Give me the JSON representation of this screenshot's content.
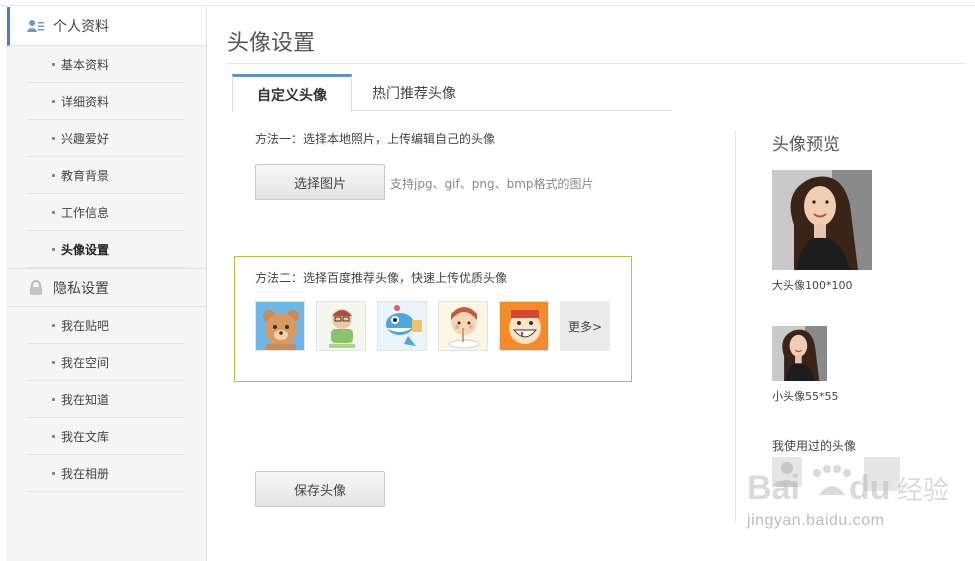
{
  "sidebar": {
    "profile_section": {
      "label": "个人资料",
      "icon": "user-card-icon"
    },
    "profile_items": [
      {
        "label": "基本资料"
      },
      {
        "label": "详细资料"
      },
      {
        "label": "兴趣爱好"
      },
      {
        "label": "教育背景"
      },
      {
        "label": "工作信息"
      },
      {
        "label": "头像设置",
        "current": true
      }
    ],
    "privacy_section": {
      "label": "隐私设置",
      "icon": "lock-icon"
    },
    "privacy_items": [
      {
        "label": "我在贴吧"
      },
      {
        "label": "我在空间"
      },
      {
        "label": "我在知道"
      },
      {
        "label": "我在文库"
      },
      {
        "label": "我在相册"
      }
    ]
  },
  "main": {
    "title": "头像设置",
    "tabs": [
      {
        "label": "自定义头像",
        "active": true
      },
      {
        "label": "热门推荐头像",
        "active": false
      }
    ],
    "method1": {
      "text": "方法一：选择本地照片，上传编辑自己的头像",
      "button": "选择图片",
      "hint": "支持jpg、gif、png、bmp格式的图片"
    },
    "method2": {
      "text": "方法二：选择百度推荐头像，快速上传优质头像",
      "avatars": [
        "bear-avatar",
        "grandpa-avatar",
        "fish-avatar",
        "girl-eating-avatar",
        "smiling-face-avatar"
      ],
      "more": "更多>"
    },
    "save_button": "保存头像"
  },
  "preview": {
    "title": "头像预览",
    "big_caption": "大头像100*100",
    "small_caption": "小头像55*55",
    "used_title": "我使用过的头像"
  },
  "watermark": {
    "logo": "Baidu经验",
    "url": "jingyan.baidu.com"
  },
  "colors": {
    "active_tab_border": "#5a8fd0",
    "sidebar_active_border": "#4a7fc1",
    "recommend_box_border": "#a9c447"
  }
}
